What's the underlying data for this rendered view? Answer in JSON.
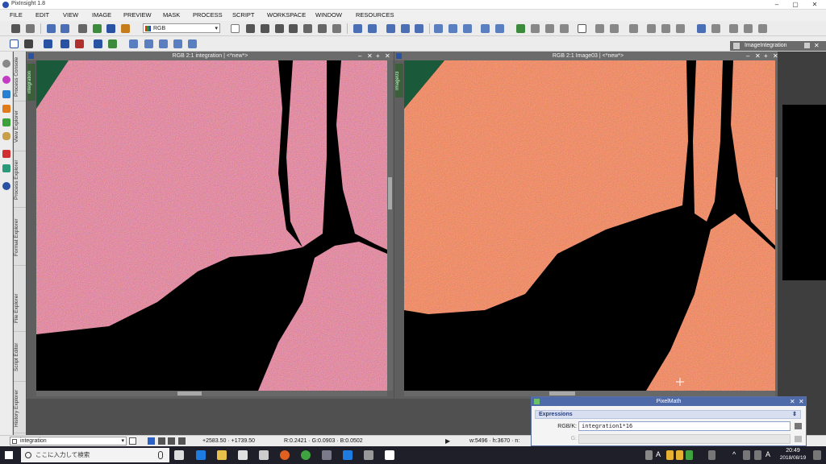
{
  "window": {
    "title": "PixInsight 1.8",
    "controls": [
      "–",
      "▢",
      "✕"
    ]
  },
  "menu": [
    "FILE",
    "EDIT",
    "VIEW",
    "IMAGE",
    "PREVIEW",
    "MASK",
    "PROCESS",
    "SCRIPT",
    "WORKSPACE",
    "WINDOW",
    "RESOURCES"
  ],
  "toolbar": {
    "color_space": "RGB"
  },
  "dock_tabs": [
    "Process Console",
    "View Explorer",
    "Process Explorer",
    "Format Explorer",
    "File Explorer",
    "Script Editor",
    "History Explorer"
  ],
  "image_windows": [
    {
      "title": "RGB 2:1 integration | <*new*>",
      "side_tab": "integration",
      "buttons": [
        "–",
        "✕",
        "+",
        "✕"
      ]
    },
    {
      "title": "RGB 2:1 Image03 | <*new*>",
      "side_tab": "Image03",
      "buttons": [
        "–",
        "✕",
        "+",
        "✕"
      ]
    }
  ],
  "image_integration_panel": {
    "title": "ImageIntegration"
  },
  "pixelmath": {
    "title": "PixelMath",
    "section": "Expressions",
    "rows": [
      {
        "label": "RGB/K:",
        "value": "integration1*16"
      },
      {
        "label": "G:",
        "value": ""
      }
    ]
  },
  "statusbar": {
    "view": "integration",
    "coords": "+2583.50  ·  +1739.50",
    "pixel": "R:0.2421  ·  G:0.0903  ·  B:0.0502",
    "geometry": "w:5496  ·  h:3670  ·  n:"
  },
  "taskbar": {
    "search_placeholder": "ここに入力して検索",
    "time": "20:49",
    "date": "2018/08/19",
    "ime": "A"
  },
  "colors": {
    "accent": "#4f6aa8",
    "nebula": "#b03818",
    "background": "#000000"
  }
}
